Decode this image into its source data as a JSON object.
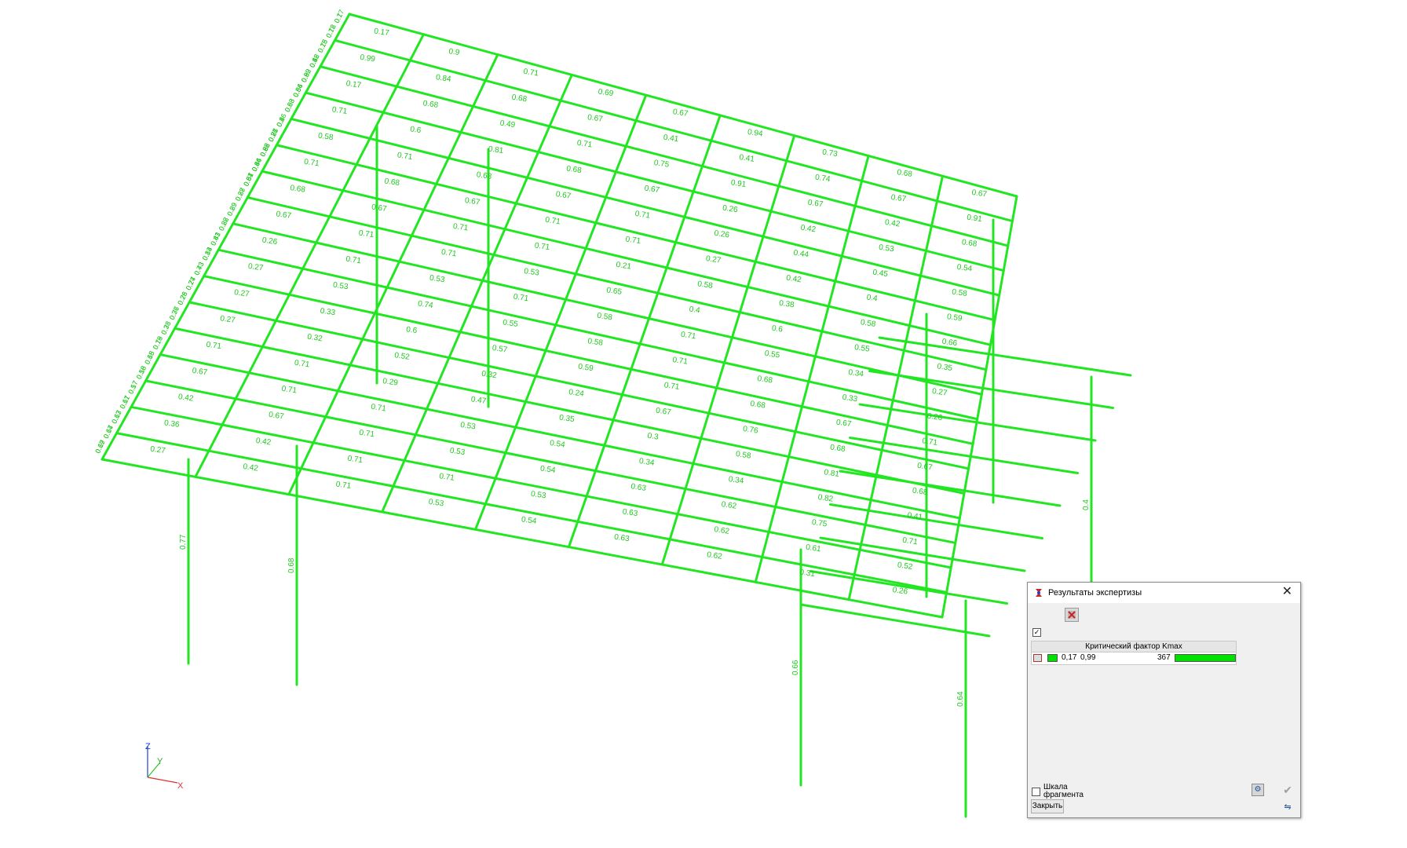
{
  "colors": {
    "beam": "#22e622",
    "label": "#1ec81e",
    "axis_z": "#1a3fd4",
    "axis_y": "#22cc22",
    "axis_x": "#e03030"
  },
  "axes": {
    "x": "X",
    "y": "Y",
    "z": "Z"
  },
  "dialog": {
    "title": "Результаты экспертизы",
    "close_glyph": "✕",
    "table_header": "Критический фактор Kmax",
    "row": {
      "min": "0,17",
      "max": "0,99",
      "count": "367"
    },
    "scale_label": "Шкала фрагмента",
    "close_button": "Закрыть",
    "icons": {
      "app": "sapr-logo-icon",
      "delete": "delete-results-icon",
      "settings": "settings-icon",
      "apply": "checkmark-icon",
      "mirror": "mirror-icon"
    }
  },
  "labels": [
    "0.17",
    "0.9",
    "0.71",
    "0.69",
    "0.67",
    "0.94",
    "0.73",
    "0.68",
    "0.67",
    "0.99",
    "0.84",
    "0.68",
    "0.67",
    "0.41",
    "0.41",
    "0.74",
    "0.67",
    "0.91",
    "0.17",
    "0.68",
    "0.49",
    "0.71",
    "0.75",
    "0.91",
    "0.67",
    "0.42",
    "0.68",
    "0.71",
    "0.6",
    "0.81",
    "0.68",
    "0.67",
    "0.26",
    "0.42",
    "0.53",
    "0.54",
    "0.58",
    "0.71",
    "0.68",
    "0.67",
    "0.71",
    "0.26",
    "0.44",
    "0.45",
    "0.58",
    "0.71",
    "0.68",
    "0.67",
    "0.71",
    "0.71",
    "0.27",
    "0.42",
    "0.4",
    "0.59",
    "0.68",
    "0.67",
    "0.71",
    "0.71",
    "0.21",
    "0.58",
    "0.38",
    "0.58",
    "0.66",
    "0.67",
    "0.71",
    "0.71",
    "0.53",
    "0.65",
    "0.4",
    "0.6",
    "0.55",
    "0.35",
    "0.26",
    "0.71",
    "0.53",
    "0.71",
    "0.58",
    "0.71",
    "0.55",
    "0.34",
    "0.27",
    "0.27",
    "0.53",
    "0.74",
    "0.55",
    "0.58",
    "0.71",
    "0.68",
    "0.33",
    "0.26",
    "0.27",
    "0.33",
    "0.6",
    "0.57",
    "0.59",
    "0.71",
    "0.68",
    "0.67",
    "0.71",
    "0.27",
    "0.32",
    "0.52",
    "0.32",
    "0.24",
    "0.67",
    "0.76",
    "0.68",
    "0.67",
    "0.71",
    "0.71",
    "0.29",
    "0.47",
    "0.35",
    "0.3",
    "0.58",
    "0.81",
    "0.68",
    "0.67",
    "0.71",
    "0.71",
    "0.53",
    "0.54",
    "0.34",
    "0.34",
    "0.82",
    "0.41",
    "0.42",
    "0.67",
    "0.71",
    "0.53",
    "0.54",
    "0.63",
    "0.62",
    "0.75",
    "0.71",
    "0.36",
    "0.42",
    "0.71",
    "0.71",
    "0.53",
    "0.63",
    "0.62",
    "0.61",
    "0.52",
    "0.27",
    "0.42",
    "0.71",
    "0.53",
    "0.54",
    "0.63",
    "0.62",
    "0.31",
    "0.26",
    "0.42",
    "0.99",
    "0.54",
    "0.63",
    "0.26",
    "0.26",
    "0.22",
    "0.44",
    "0.61",
    "0.27",
    "0.29",
    "0.28",
    "0.41",
    "0.13",
    "0.43",
    "0.27",
    "0.28",
    "0.36",
    "0.33",
    "0.18",
    "0.18",
    "0.18",
    "0.17",
    "0.17",
    "0.17",
    "0.17",
    "0.17",
    "0.17",
    "0.18",
    "0.18",
    "0.18",
    "0.8",
    "0.8",
    "0.8",
    "0.8",
    "0.81",
    "0.85",
    "0.86",
    "0.87",
    "0.88",
    "0.89",
    "0.82",
    "0.83",
    "0.84",
    "0.73",
    "0.74",
    "0.76",
    "0.77",
    "0.78",
    "0.79",
    "0.65",
    "0.56",
    "0.57",
    "0.61",
    "0.63",
    "0.64",
    "0.69",
    "0.7",
    "0.72",
    "0.75",
    "0.6",
    "0.62",
    "0.66",
    "0.68",
    "0.4",
    "0.77",
    "0.68",
    "0.66",
    "0.64"
  ],
  "column_labels": [
    "0.77",
    "0.68",
    "0.66",
    "0.64",
    "0.4"
  ]
}
